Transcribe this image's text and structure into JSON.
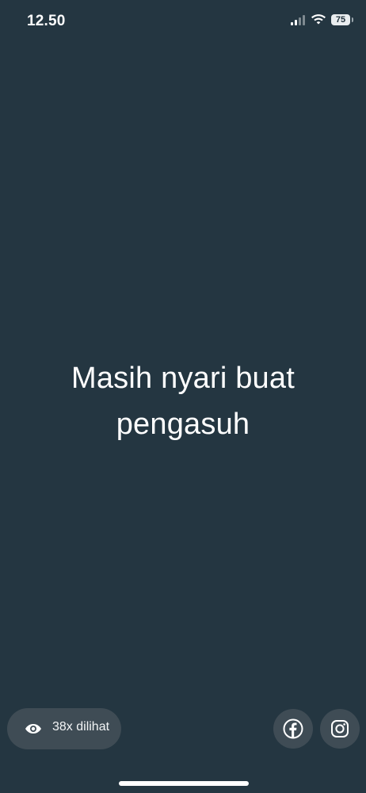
{
  "status_bar": {
    "time": "12.50",
    "battery": "75",
    "icons": [
      "signal-icon",
      "wifi-icon",
      "battery-icon"
    ]
  },
  "content": {
    "line1": "Masih nyari buat",
    "line2": "pengasuh"
  },
  "views": {
    "label": "38x dilihat",
    "icon": "eye-icon"
  },
  "social": {
    "facebook_icon": "facebook-icon",
    "instagram_icon": "instagram-icon"
  },
  "colors": {
    "background": "#243641",
    "pill": "#3f4c55",
    "text": "#ffffff"
  }
}
